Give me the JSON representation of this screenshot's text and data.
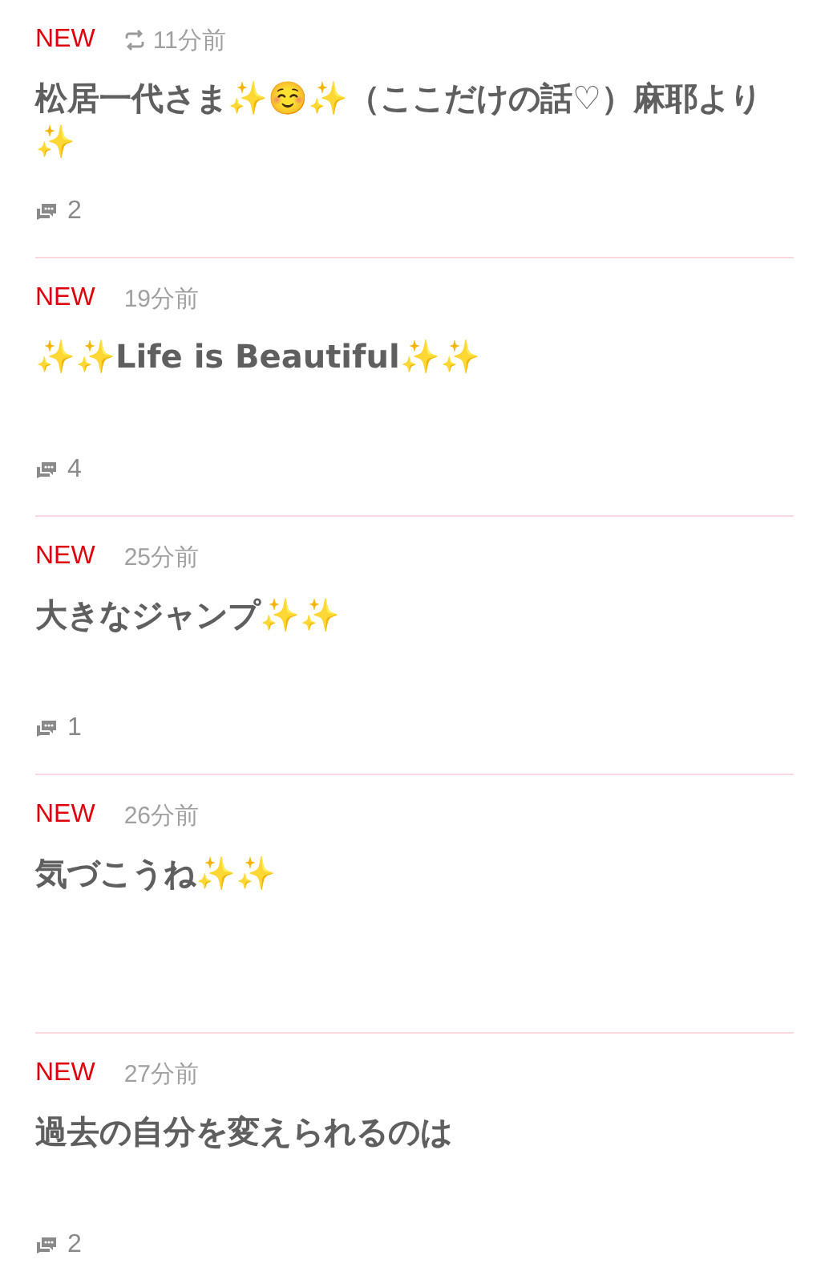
{
  "posts": [
    {
      "badge": "NEW",
      "reblogged": true,
      "time": "11分前",
      "title": "松居一代さま✨☺️✨（ここだけの話♡）麻耶より✨",
      "comments": "2"
    },
    {
      "badge": "NEW",
      "reblogged": false,
      "time": "19分前",
      "title": "✨✨Life is Beautiful✨✨",
      "comments": "4"
    },
    {
      "badge": "NEW",
      "reblogged": false,
      "time": "25分前",
      "title": "大きなジャンプ✨✨",
      "comments": "1"
    },
    {
      "badge": "NEW",
      "reblogged": false,
      "time": "26分前",
      "title": "気づこうね✨✨"
    },
    {
      "badge": "NEW",
      "reblogged": false,
      "time": "27分前",
      "title": "過去の自分を変えられるのは",
      "comments": "2"
    }
  ]
}
